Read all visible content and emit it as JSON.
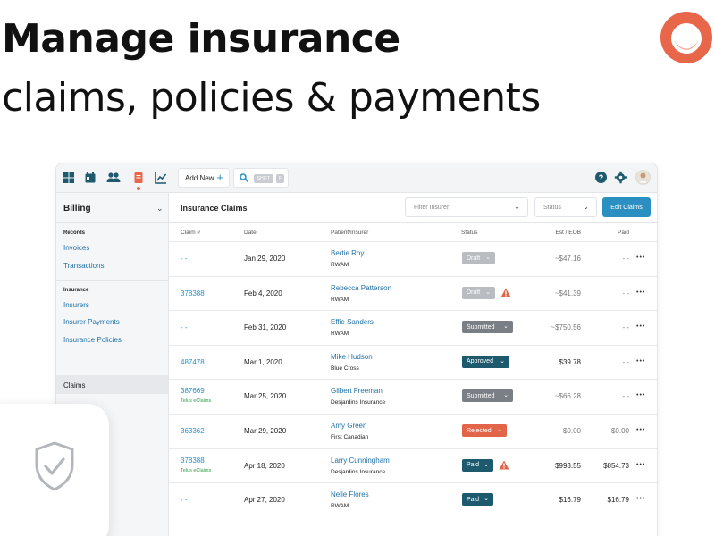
{
  "hero": {
    "line1": "Manage insurance",
    "line2": "claims, policies & payments",
    "brand_color": "#e8674a"
  },
  "topbar": {
    "add_new_label": "Add New",
    "shortcut_key1": "SHIFT",
    "shortcut_key2": "F",
    "nav_icons": [
      "dashboard-icon",
      "calendar-icon",
      "people-icon",
      "billing-icon",
      "reports-icon"
    ],
    "active_nav": "billing-icon"
  },
  "sidebar": {
    "title": "Billing",
    "sections": [
      {
        "label": "Records",
        "items": [
          "Invoices",
          "Transactions"
        ]
      },
      {
        "label": "Insurance",
        "items": [
          "Insurers",
          "Insurer Payments",
          "Insurance Policies",
          "Claims"
        ]
      }
    ],
    "active_item": "Claims"
  },
  "main": {
    "title": "Insurance Claims",
    "filter_insurer_placeholder": "Filter Insurer",
    "status_placeholder": "Status",
    "edit_button": "Edit Claims",
    "columns": {
      "claim": "Claim #",
      "date": "Date",
      "patient": "Patient/Insurer",
      "status": "Status",
      "est": "Est / EOB",
      "paid": "Paid"
    },
    "rows": [
      {
        "claim": "- -",
        "claim_sub": "",
        "date": "Jan 29, 2020",
        "patient": "Bertie Roy",
        "insurer": "RWAM",
        "status": "Draft",
        "warning": false,
        "est": "~$47.16",
        "paid": "- -"
      },
      {
        "claim": "378388",
        "claim_sub": "",
        "date": "Feb 4, 2020",
        "patient": "Rebecca Patterson",
        "insurer": "RWAM",
        "status": "Draft",
        "warning": true,
        "est": "~$41.39",
        "paid": "- -"
      },
      {
        "claim": "- -",
        "claim_sub": "",
        "date": "Feb 31, 2020",
        "patient": "Effie Sanders",
        "insurer": "RWAM",
        "status": "Submitted",
        "warning": false,
        "est": "~$750.56",
        "paid": "- -"
      },
      {
        "claim": "487478",
        "claim_sub": "",
        "date": "Mar 1, 2020",
        "patient": "Mike Hudson",
        "insurer": "Blue Cross",
        "status": "Approved",
        "warning": false,
        "est": "$39.78",
        "paid": "- -"
      },
      {
        "claim": "387669",
        "claim_sub": "Telus eClaims",
        "date": "Mar 25, 2020",
        "patient": "Gilbert Freeman",
        "insurer": "Desjardins Insurance",
        "status": "Submitted",
        "warning": false,
        "est": "~$66.28",
        "paid": "- -"
      },
      {
        "claim": "363362",
        "claim_sub": "",
        "date": "Mar 29, 2020",
        "patient": "Amy Green",
        "insurer": "First Canadian",
        "status": "Rejected",
        "warning": false,
        "est": "$0.00",
        "paid": "$0.00"
      },
      {
        "claim": "378388",
        "claim_sub": "Telus eClaims",
        "date": "Apr 18, 2020",
        "patient": "Larry Cunningham",
        "insurer": "Desjardins Insurance",
        "status": "Paid",
        "warning": true,
        "est": "$993.55",
        "paid": "$854.73"
      },
      {
        "claim": "- -",
        "claim_sub": "",
        "date": "Apr 27, 2020",
        "patient": "Nelle Flores",
        "insurer": "RWAM",
        "status": "Paid",
        "warning": false,
        "est": "$16.79",
        "paid": "$16.79"
      }
    ]
  },
  "status_colors": {
    "Draft": "#b9bdc2",
    "Submitted": "#7a7f86",
    "Approved": "#1e5a6e",
    "Rejected": "#e2654a",
    "Paid": "#1e5a6e"
  },
  "decor": {
    "shield_icon": "shield-check-icon"
  }
}
